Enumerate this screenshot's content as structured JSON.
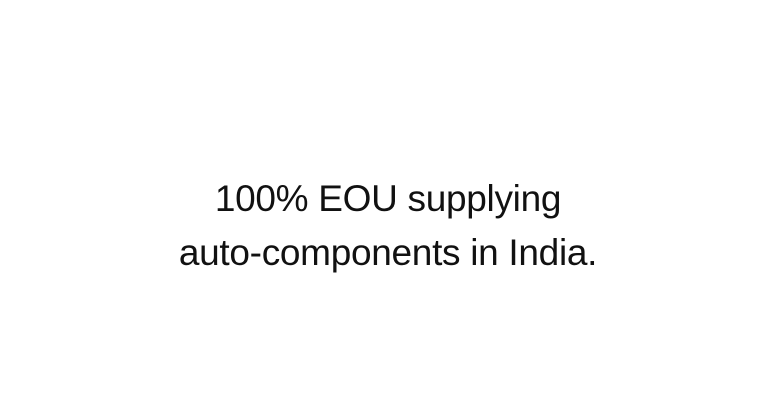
{
  "content": {
    "line1": "100% EOU supplying",
    "line2": "auto-components in India."
  },
  "colors": {
    "background": "#ffffff",
    "text": "#111111"
  }
}
